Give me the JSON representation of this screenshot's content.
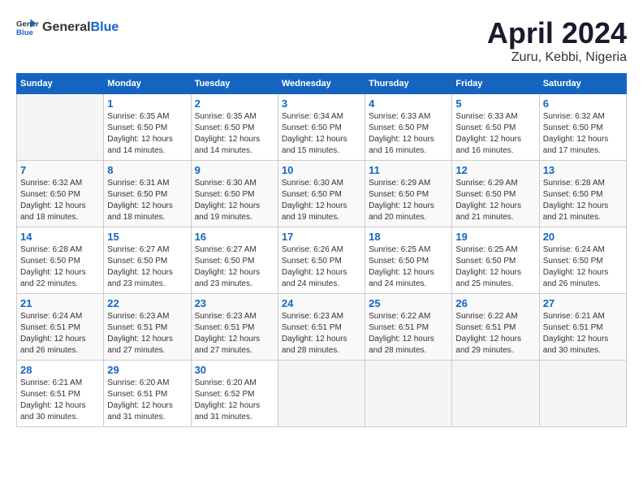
{
  "header": {
    "logo_general": "General",
    "logo_blue": "Blue",
    "month": "April 2024",
    "location": "Zuru, Kebbi, Nigeria"
  },
  "weekdays": [
    "Sunday",
    "Monday",
    "Tuesday",
    "Wednesday",
    "Thursday",
    "Friday",
    "Saturday"
  ],
  "weeks": [
    [
      {
        "day": "",
        "sunrise": "",
        "sunset": "",
        "daylight": ""
      },
      {
        "day": "1",
        "sunrise": "Sunrise: 6:35 AM",
        "sunset": "Sunset: 6:50 PM",
        "daylight": "Daylight: 12 hours and 14 minutes."
      },
      {
        "day": "2",
        "sunrise": "Sunrise: 6:35 AM",
        "sunset": "Sunset: 6:50 PM",
        "daylight": "Daylight: 12 hours and 14 minutes."
      },
      {
        "day": "3",
        "sunrise": "Sunrise: 6:34 AM",
        "sunset": "Sunset: 6:50 PM",
        "daylight": "Daylight: 12 hours and 15 minutes."
      },
      {
        "day": "4",
        "sunrise": "Sunrise: 6:33 AM",
        "sunset": "Sunset: 6:50 PM",
        "daylight": "Daylight: 12 hours and 16 minutes."
      },
      {
        "day": "5",
        "sunrise": "Sunrise: 6:33 AM",
        "sunset": "Sunset: 6:50 PM",
        "daylight": "Daylight: 12 hours and 16 minutes."
      },
      {
        "day": "6",
        "sunrise": "Sunrise: 6:32 AM",
        "sunset": "Sunset: 6:50 PM",
        "daylight": "Daylight: 12 hours and 17 minutes."
      }
    ],
    [
      {
        "day": "7",
        "sunrise": "Sunrise: 6:32 AM",
        "sunset": "Sunset: 6:50 PM",
        "daylight": "Daylight: 12 hours and 18 minutes."
      },
      {
        "day": "8",
        "sunrise": "Sunrise: 6:31 AM",
        "sunset": "Sunset: 6:50 PM",
        "daylight": "Daylight: 12 hours and 18 minutes."
      },
      {
        "day": "9",
        "sunrise": "Sunrise: 6:30 AM",
        "sunset": "Sunset: 6:50 PM",
        "daylight": "Daylight: 12 hours and 19 minutes."
      },
      {
        "day": "10",
        "sunrise": "Sunrise: 6:30 AM",
        "sunset": "Sunset: 6:50 PM",
        "daylight": "Daylight: 12 hours and 19 minutes."
      },
      {
        "day": "11",
        "sunrise": "Sunrise: 6:29 AM",
        "sunset": "Sunset: 6:50 PM",
        "daylight": "Daylight: 12 hours and 20 minutes."
      },
      {
        "day": "12",
        "sunrise": "Sunrise: 6:29 AM",
        "sunset": "Sunset: 6:50 PM",
        "daylight": "Daylight: 12 hours and 21 minutes."
      },
      {
        "day": "13",
        "sunrise": "Sunrise: 6:28 AM",
        "sunset": "Sunset: 6:50 PM",
        "daylight": "Daylight: 12 hours and 21 minutes."
      }
    ],
    [
      {
        "day": "14",
        "sunrise": "Sunrise: 6:28 AM",
        "sunset": "Sunset: 6:50 PM",
        "daylight": "Daylight: 12 hours and 22 minutes."
      },
      {
        "day": "15",
        "sunrise": "Sunrise: 6:27 AM",
        "sunset": "Sunset: 6:50 PM",
        "daylight": "Daylight: 12 hours and 23 minutes."
      },
      {
        "day": "16",
        "sunrise": "Sunrise: 6:27 AM",
        "sunset": "Sunset: 6:50 PM",
        "daylight": "Daylight: 12 hours and 23 minutes."
      },
      {
        "day": "17",
        "sunrise": "Sunrise: 6:26 AM",
        "sunset": "Sunset: 6:50 PM",
        "daylight": "Daylight: 12 hours and 24 minutes."
      },
      {
        "day": "18",
        "sunrise": "Sunrise: 6:25 AM",
        "sunset": "Sunset: 6:50 PM",
        "daylight": "Daylight: 12 hours and 24 minutes."
      },
      {
        "day": "19",
        "sunrise": "Sunrise: 6:25 AM",
        "sunset": "Sunset: 6:50 PM",
        "daylight": "Daylight: 12 hours and 25 minutes."
      },
      {
        "day": "20",
        "sunrise": "Sunrise: 6:24 AM",
        "sunset": "Sunset: 6:50 PM",
        "daylight": "Daylight: 12 hours and 26 minutes."
      }
    ],
    [
      {
        "day": "21",
        "sunrise": "Sunrise: 6:24 AM",
        "sunset": "Sunset: 6:51 PM",
        "daylight": "Daylight: 12 hours and 26 minutes."
      },
      {
        "day": "22",
        "sunrise": "Sunrise: 6:23 AM",
        "sunset": "Sunset: 6:51 PM",
        "daylight": "Daylight: 12 hours and 27 minutes."
      },
      {
        "day": "23",
        "sunrise": "Sunrise: 6:23 AM",
        "sunset": "Sunset: 6:51 PM",
        "daylight": "Daylight: 12 hours and 27 minutes."
      },
      {
        "day": "24",
        "sunrise": "Sunrise: 6:23 AM",
        "sunset": "Sunset: 6:51 PM",
        "daylight": "Daylight: 12 hours and 28 minutes."
      },
      {
        "day": "25",
        "sunrise": "Sunrise: 6:22 AM",
        "sunset": "Sunset: 6:51 PM",
        "daylight": "Daylight: 12 hours and 28 minutes."
      },
      {
        "day": "26",
        "sunrise": "Sunrise: 6:22 AM",
        "sunset": "Sunset: 6:51 PM",
        "daylight": "Daylight: 12 hours and 29 minutes."
      },
      {
        "day": "27",
        "sunrise": "Sunrise: 6:21 AM",
        "sunset": "Sunset: 6:51 PM",
        "daylight": "Daylight: 12 hours and 30 minutes."
      }
    ],
    [
      {
        "day": "28",
        "sunrise": "Sunrise: 6:21 AM",
        "sunset": "Sunset: 6:51 PM",
        "daylight": "Daylight: 12 hours and 30 minutes."
      },
      {
        "day": "29",
        "sunrise": "Sunrise: 6:20 AM",
        "sunset": "Sunset: 6:51 PM",
        "daylight": "Daylight: 12 hours and 31 minutes."
      },
      {
        "day": "30",
        "sunrise": "Sunrise: 6:20 AM",
        "sunset": "Sunset: 6:52 PM",
        "daylight": "Daylight: 12 hours and 31 minutes."
      },
      {
        "day": "",
        "sunrise": "",
        "sunset": "",
        "daylight": ""
      },
      {
        "day": "",
        "sunrise": "",
        "sunset": "",
        "daylight": ""
      },
      {
        "day": "",
        "sunrise": "",
        "sunset": "",
        "daylight": ""
      },
      {
        "day": "",
        "sunrise": "",
        "sunset": "",
        "daylight": ""
      }
    ]
  ]
}
